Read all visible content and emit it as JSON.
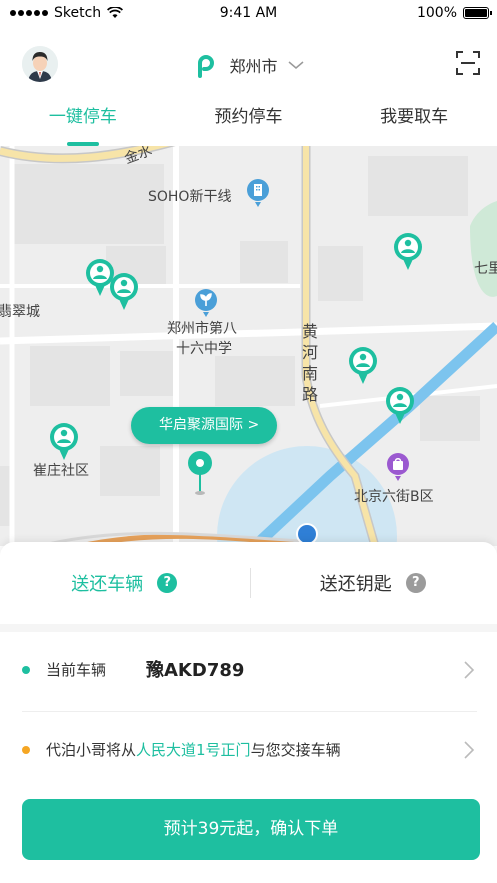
{
  "status_bar": {
    "carrier": "Sketch",
    "time": "9:41 AM",
    "battery": "100%"
  },
  "header": {
    "city": "郑州市"
  },
  "tabs": [
    {
      "label": "一键停车",
      "active": true
    },
    {
      "label": "预约停车",
      "active": false
    },
    {
      "label": "我要取车",
      "active": false
    }
  ],
  "map": {
    "labels": {
      "jin": "金水",
      "soho": "SOHO新干线",
      "feicui": "翡翠城",
      "school_line1": "郑州市第八",
      "school_line2": "十六中学",
      "road_1": "黄",
      "road_2": "河",
      "road_3": "南",
      "road_4": "路",
      "cuizhuang": "崔庄社区",
      "beijing": "北京六街B区",
      "edge": "七里"
    },
    "callout": "华启聚源国际 >",
    "pin_color": "#1ebfa0"
  },
  "sheet": {
    "segments": [
      {
        "label": "送还车辆",
        "active": true,
        "help": "?"
      },
      {
        "label": "送还钥匙",
        "active": false,
        "help": "?"
      }
    ],
    "current_vehicle_label": "当前车辆",
    "plate": "豫AKD789",
    "handover": {
      "prefix": "代泊小哥将从",
      "place": "人民大道1号正门",
      "suffix": "与您交接车辆"
    },
    "confirm_label": "预计39元起，确认下单"
  },
  "colors": {
    "accent": "#1ebfa0",
    "orange_dot": "#f5a623",
    "help_gray": "#9b9b9b"
  }
}
